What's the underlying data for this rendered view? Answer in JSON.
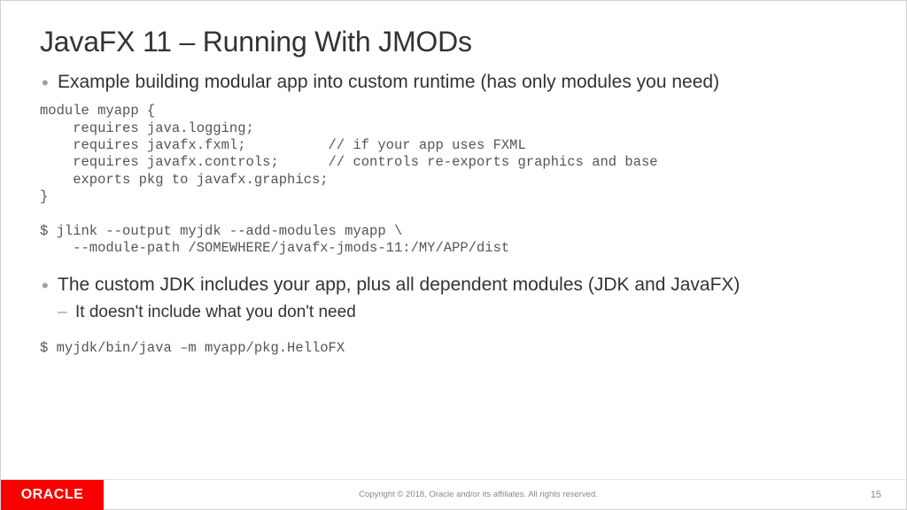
{
  "title": "JavaFX 11 – Running With JMODs",
  "bullets": {
    "b1": "Example building modular app into custom runtime (has only modules you need)",
    "b2": "The custom JDK includes your app, plus all dependent modules (JDK and JavaFX)",
    "b2_sub1": "It doesn't include what you don't need"
  },
  "code1": "module myapp {\n    requires java.logging;\n    requires javafx.fxml;          // if your app uses FXML\n    requires javafx.controls;      // controls re-exports graphics and base\n    exports pkg to javafx.graphics;\n}\n\n$ jlink --output myjdk --add-modules myapp \\\n    --module-path /SOMEWHERE/javafx-jmods-11:/MY/APP/dist",
  "code2": "$ myjdk/bin/java –m myapp/pkg.HelloFX",
  "footer": {
    "logo": "ORACLE",
    "copyright": "Copyright © 2018, Oracle and/or its affiliates. All rights reserved.",
    "page": "15"
  }
}
